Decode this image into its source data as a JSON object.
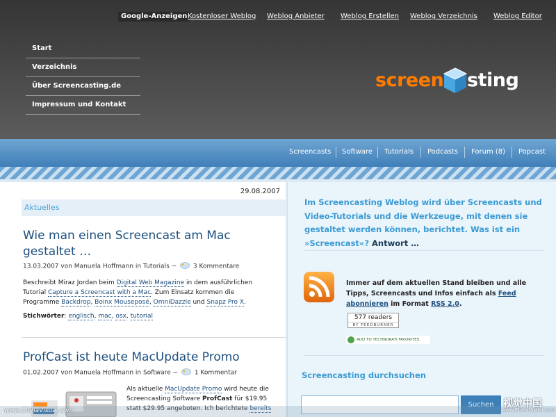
{
  "ads": {
    "title": "Google-Anzeigen",
    "links": [
      "Kostenloser Weblog",
      "Weblog Anbieter",
      "Weblog Erstellen",
      "Weblog Verzeichnis",
      "Weblog Editor"
    ]
  },
  "side_nav": [
    "Start",
    "Verzeichnis",
    "Über Screencasting.de",
    "Impressum und Kontakt"
  ],
  "logo": {
    "part1": "screenc",
    "part2": "sting"
  },
  "main_nav": [
    "Screencasts",
    "Software",
    "Tutorials",
    "Podcasts",
    "Forum (8)",
    "Popcast"
  ],
  "content": {
    "date": "29.08.2007",
    "section": "Aktuelles",
    "post1": {
      "title": "Wie man einen Screencast am Mac gestaltet …",
      "meta_prefix": "13.03.2007 von Manuela Hoffmann in Tutorials ~",
      "comments": "3 Kommentare",
      "body_1": "Beschreibt Miraz Jordan beim ",
      "link_1": "Digital Web Magazine",
      "body_2": " in dem ausführlichen Tutorial ",
      "link_2": "Capture a Screencast with a Mac",
      "body_3": ". Zum Einsatz kommen die Programme ",
      "link_3": "Backdrop",
      "sep_1": ", ",
      "link_4": "Boinx Mouseposé",
      "sep_2": ", ",
      "link_5": "OmniDazzle",
      "sep_3": " und ",
      "link_6": "Snapz Pro X",
      "body_4": ".",
      "tags_label": "Stichwörter",
      "tags": [
        "englisch",
        "mac",
        "osx",
        "tutorial"
      ]
    },
    "post2": {
      "title": "ProfCast ist heute MacUpdate Promo",
      "meta_prefix": "01.02.2007 von Manuela Hoffmann in Software ~",
      "comments": "1 Kommentar",
      "body_1": "Als aktuelle ",
      "link_1": "MacUpdate Promo",
      "body_2": " wird heute die Screencasting Software ",
      "strong": "ProfCast",
      "body_3": " für $19.95 statt $29.95 angeboten. Ich berichtete ",
      "link_2": "bereits"
    }
  },
  "sidebar": {
    "intro": "Im Screencasting Weblog wird über Screencasts und Video-Tutorials und die Werkzeuge, mit denen sie gestaltet werden können, berichtet. Was ist ein »Screencast«?",
    "intro_more": "Antwort …",
    "subscribe_1": "Immer auf dem aktuellen Stand bleiben und alle Tipps, Screencasts und Infos einfach als ",
    "subscribe_link": "Feed abonnieren",
    "subscribe_2": " im Format ",
    "subscribe_link2": "RSS 2.0",
    "subscribe_3": ".",
    "feedburner_count": "577 readers",
    "feedburner_by": "BY FEEDBURNER",
    "technorati": "ADD TO TECHNORATI FAVORITES",
    "search_heading": "Screencasting durchsuchen",
    "search_value": "",
    "search_button": "Suchen"
  },
  "watermark": {
    "left": "www.ChinaVisual.com",
    "right_cn": "视觉中国",
    "right_url": "www.ChinaVisual.com"
  },
  "colors": {
    "accent": "#3a9bd3",
    "link": "#1c4f7e",
    "orange": "#ff7b00",
    "nav_blue": "#3f7fb8"
  }
}
